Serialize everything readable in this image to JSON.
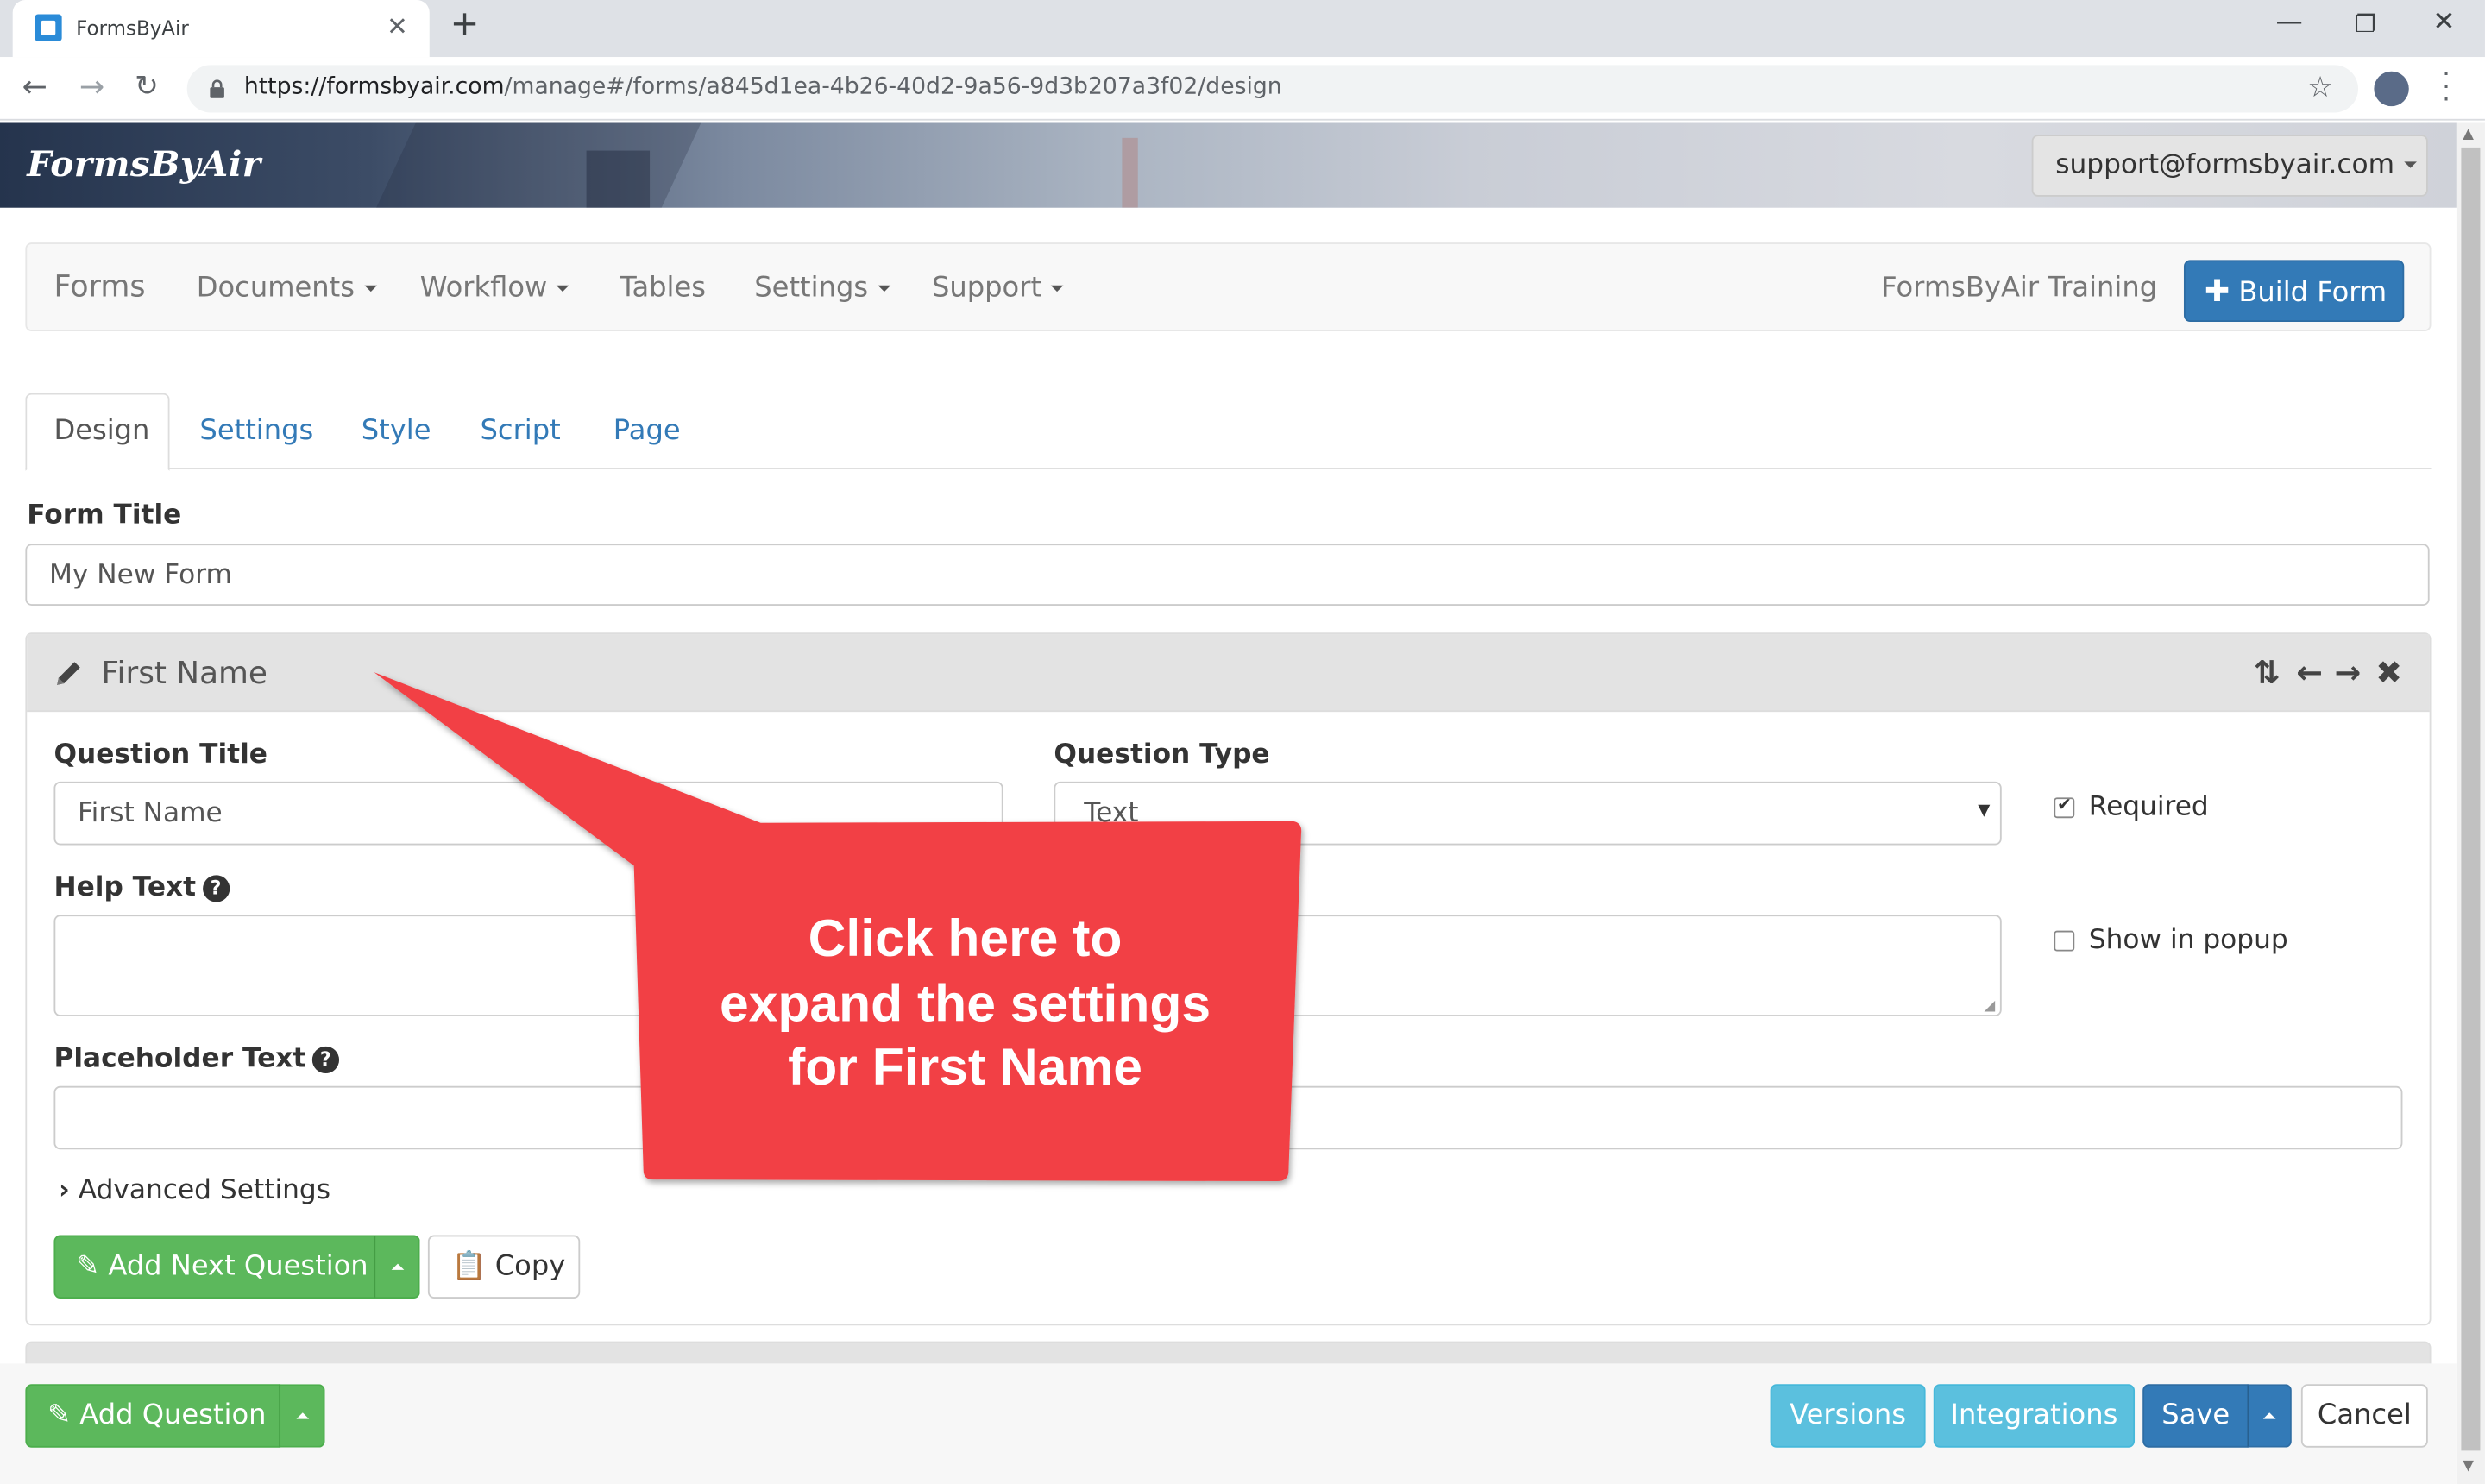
{
  "browser": {
    "tab_title": "FormsByAir",
    "tab_close_icon": "close-icon",
    "new_tab_icon": "plus-icon",
    "url_host": "https://formsbyair.com",
    "url_path": "/manage#/forms/a845d1ea-4b26-40d2-9a56-9d3b207a3f02/design",
    "window_controls": [
      "minimize-icon",
      "restore-icon",
      "close-icon"
    ]
  },
  "app": {
    "logo": "FormsByAir",
    "user_menu": "support@formsbyair.com"
  },
  "nav": {
    "brand": "Forms",
    "items": [
      {
        "label": "Documents",
        "dropdown": true
      },
      {
        "label": "Workflow",
        "dropdown": true
      },
      {
        "label": "Tables",
        "dropdown": false
      },
      {
        "label": "Settings",
        "dropdown": true
      },
      {
        "label": "Support",
        "dropdown": true
      }
    ],
    "org_name": "FormsByAir Training",
    "build_form": "Build Form"
  },
  "tabs": [
    "Design",
    "Settings",
    "Style",
    "Script",
    "Page"
  ],
  "active_tab": "Design",
  "form": {
    "title_label": "Form Title",
    "title_value": "My New Form"
  },
  "question": {
    "header_title": "First Name",
    "title_label": "Question Title",
    "title_value": "First Name",
    "type_label": "Question Type",
    "type_value": "Text",
    "required_label": "Required",
    "required_checked": true,
    "help_label": "Help Text",
    "show_popup_label": "Show in popup",
    "show_popup_checked": false,
    "placeholder_label": "Placeholder Text",
    "advanced_label": "Advanced Settings",
    "add_next": "Add Next Question",
    "copy": "Copy",
    "header_icons": [
      "sort-icon",
      "arrow-left-icon",
      "arrow-right-icon",
      "remove-icon"
    ]
  },
  "footer": {
    "add_question": "Add Question",
    "versions": "Versions",
    "integrations": "Integrations",
    "save": "Save",
    "cancel": "Cancel"
  },
  "callout": {
    "lines": [
      "Click here to",
      "expand the settings",
      "for First Name"
    ],
    "color": "#f24044"
  },
  "colors": {
    "primary": "#337ab7",
    "success": "#5cb85c",
    "info": "#5bc0de"
  }
}
